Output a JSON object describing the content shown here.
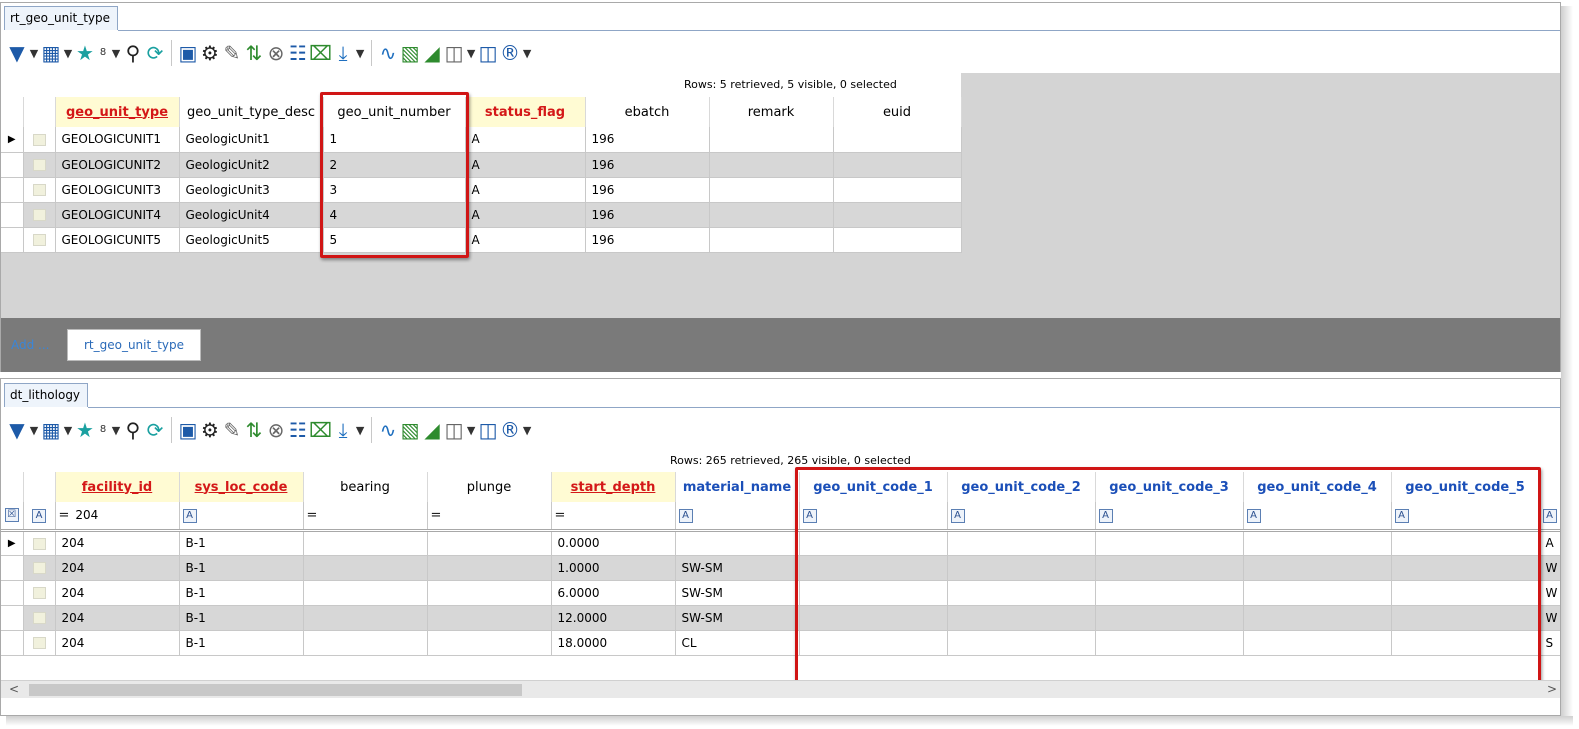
{
  "top": {
    "tab": "rt_geo_unit_type",
    "toolbar": {
      "counter": "8"
    },
    "status": "Rows: 5 retrieved, 5 visible, 0 selected",
    "columns": [
      "geo_unit_type",
      "geo_unit_type_desc",
      "geo_unit_number",
      "status_flag",
      "ebatch",
      "remark",
      "euid"
    ],
    "rows": [
      [
        "GEOLOGICUNIT1",
        "GeologicUnit1",
        "1",
        "A",
        "196",
        "",
        ""
      ],
      [
        "GEOLOGICUNIT2",
        "GeologicUnit2",
        "2",
        "A",
        "196",
        "",
        ""
      ],
      [
        "GEOLOGICUNIT3",
        "GeologicUnit3",
        "3",
        "A",
        "196",
        "",
        ""
      ],
      [
        "GEOLOGICUNIT4",
        "GeologicUnit4",
        "4",
        "A",
        "196",
        "",
        ""
      ],
      [
        "GEOLOGICUNIT5",
        "GeologicUnit5",
        "5",
        "A",
        "196",
        "",
        ""
      ]
    ],
    "current_row_marker": "▶"
  },
  "add_bar": {
    "add_label": "Add ...",
    "tab_label": "rt_geo_unit_type"
  },
  "bottom": {
    "tab": "dt_lithology",
    "toolbar": {
      "counter": "8"
    },
    "status": "Rows: 265 retrieved, 265 visible, 0 selected",
    "columns": [
      "facility_id",
      "sys_loc_code",
      "bearing",
      "plunge",
      "start_depth",
      "material_name",
      "geo_unit_code_1",
      "geo_unit_code_2",
      "geo_unit_code_3",
      "geo_unit_code_4",
      "geo_unit_code_5"
    ],
    "filter": {
      "facility_value": "204",
      "eq": "=",
      "text_icon": "A"
    },
    "rows": [
      [
        "204",
        "B-1",
        "",
        "",
        "0.0000",
        "",
        "",
        "",
        "",
        "",
        "",
        "A"
      ],
      [
        "204",
        "B-1",
        "",
        "",
        "1.0000",
        "SW-SM",
        "",
        "",
        "",
        "",
        "",
        "W"
      ],
      [
        "204",
        "B-1",
        "",
        "",
        "6.0000",
        "SW-SM",
        "",
        "",
        "",
        "",
        "",
        "W"
      ],
      [
        "204",
        "B-1",
        "",
        "",
        "12.0000",
        "SW-SM",
        "",
        "",
        "",
        "",
        "",
        "W"
      ],
      [
        "204",
        "B-1",
        "",
        "",
        "18.0000",
        "CL",
        "",
        "",
        "",
        "",
        "",
        "S"
      ]
    ],
    "current_row_marker": "▶",
    "scroll_left": "<",
    "scroll_right": ">"
  }
}
